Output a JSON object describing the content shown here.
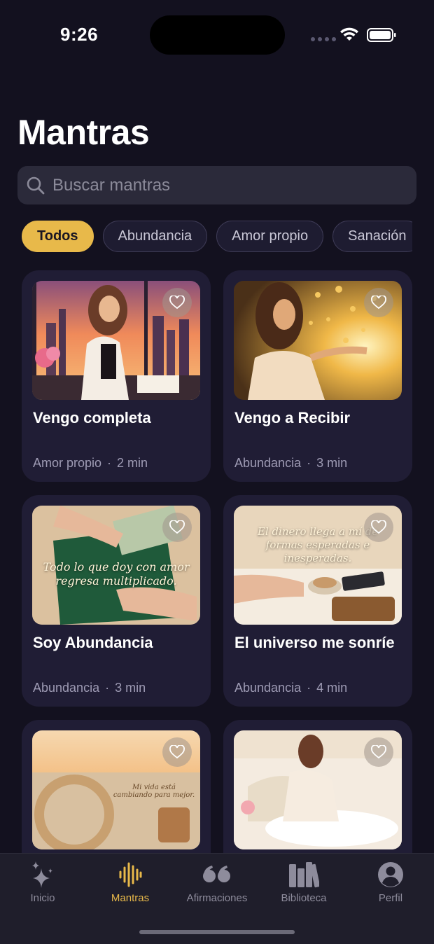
{
  "status_bar": {
    "time": "9:26"
  },
  "header": {
    "title": "Mantras"
  },
  "search": {
    "placeholder": "Buscar mantras"
  },
  "filters": [
    {
      "label": "Todos",
      "active": true
    },
    {
      "label": "Abundancia",
      "active": false
    },
    {
      "label": "Amor propio",
      "active": false
    },
    {
      "label": "Sanación",
      "active": false
    }
  ],
  "cards": [
    {
      "title": "Vengo completa",
      "category": "Amor propio",
      "duration": "2 min",
      "image": "woman-city-sunset",
      "overlay_text": ""
    },
    {
      "title": "Vengo a Recibir",
      "category": "Abundancia",
      "duration": "3 min",
      "image": "woman-golden-coins",
      "overlay_text": ""
    },
    {
      "title": "Soy Abundancia",
      "category": "Abundancia",
      "duration": "3 min",
      "image": "green-wallet-money",
      "overlay_text": "Todo lo que doy con amor regresa multiplicado."
    },
    {
      "title": "El universo me sonríe",
      "category": "Abundancia",
      "duration": "4 min",
      "image": "coffee-wallet-phone",
      "overlay_text": "El dinero llega a mí de formas esperadas e inesperadas."
    },
    {
      "title": "",
      "category": "",
      "duration": "",
      "image": "car-steering-beach",
      "overlay_text": "Mi vida está cambiando para mejor."
    },
    {
      "title": "",
      "category": "",
      "duration": "",
      "image": "woman-bed-journal",
      "overlay_text": ""
    }
  ],
  "tab_bar": {
    "items": [
      {
        "label": "Inicio",
        "icon": "sparkles-icon",
        "active": false
      },
      {
        "label": "Mantras",
        "icon": "waveform-icon",
        "active": true
      },
      {
        "label": "Afirmaciones",
        "icon": "quote-icon",
        "active": false
      },
      {
        "label": "Biblioteca",
        "icon": "books-icon",
        "active": false
      },
      {
        "label": "Perfil",
        "icon": "person-circle-icon",
        "active": false
      }
    ]
  },
  "colors": {
    "background": "#13111f",
    "accent": "#e8b94a",
    "card": "#201d35"
  }
}
